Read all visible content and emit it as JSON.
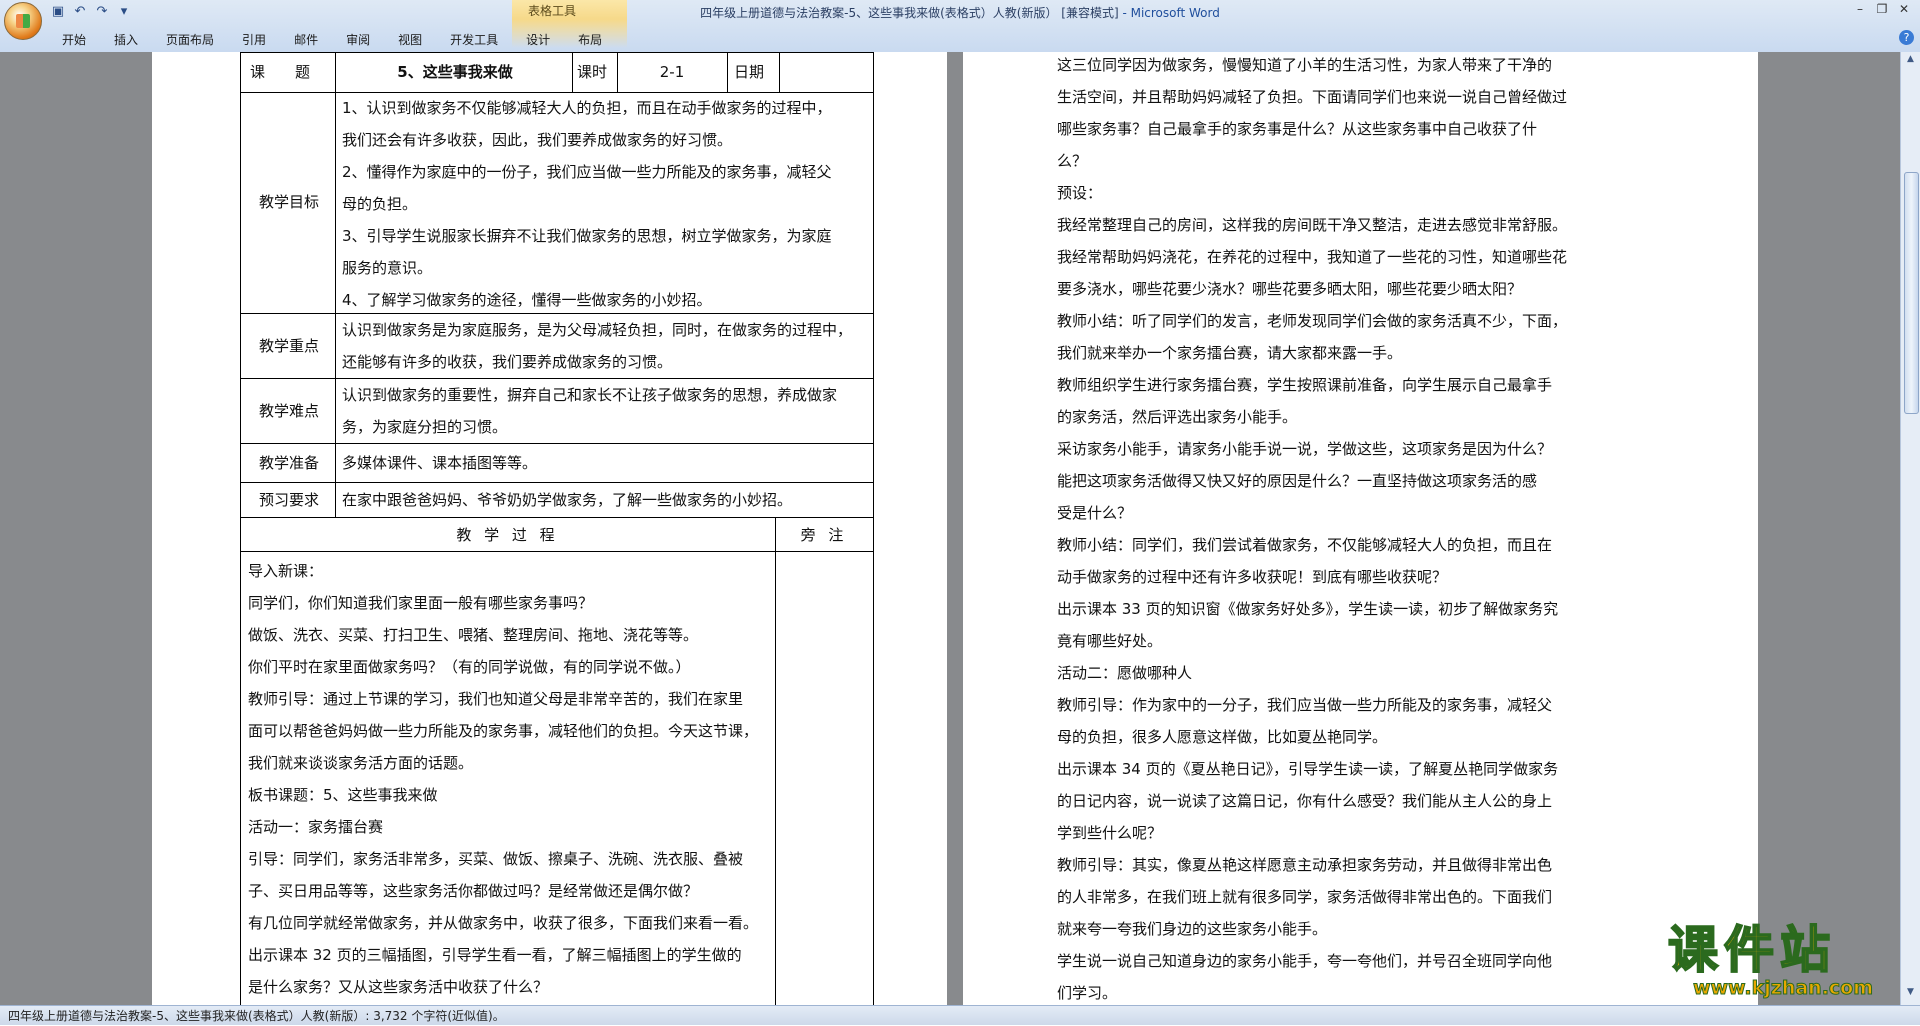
{
  "window": {
    "title": "四年级上册道德与法治教案-5、这些事我来做(表格式）人教(新版） [兼容模式]",
    "app_name": " - Microsoft Word",
    "context_tab_group": "表格工具"
  },
  "ribbon": {
    "tabs": [
      "开始",
      "插入",
      "页面布局",
      "引用",
      "邮件",
      "审阅",
      "视图",
      "开发工具",
      "设计",
      "布局"
    ]
  },
  "lesson_table": {
    "topic_label": "课　　题",
    "topic_value": "5、这些事我来做",
    "period_label": "课时",
    "period_value": "2-1",
    "date_label": "日期",
    "goals_label": "教学目标",
    "goals_lines": [
      "1、认识到做家务不仅能够减轻大人的负担，而且在动手做家务的过程中，",
      "我们还会有许多收获，因此，我们要养成做家务的好习惯。",
      "2、懂得作为家庭中的一份子，我们应当做一些力所能及的家务事，减轻父",
      "母的负担。",
      "3、引导学生说服家长摒弃不让我们做家务的思想，树立学做家务，为家庭",
      "服务的意识。",
      "4、了解学习做家务的途径，懂得一些做家务的小妙招。"
    ],
    "focus_label": "教学重点",
    "focus_lines": [
      "认识到做家务是为家庭服务，是为父母减轻负担，同时，在做家务的过程中，",
      "还能够有许多的收获，我们要养成做家务的习惯。"
    ],
    "difficulty_label": "教学难点",
    "difficulty_lines": [
      "认识到做家务的重要性，摒弃自己和家长不让孩子做家务的思想，养成做家",
      "务，为家庭分担的习惯。"
    ],
    "prep_label": "教学准备",
    "prep_value": "多媒体课件、课本插图等等。",
    "preview_label": "预习要求",
    "preview_value": "在家中跟爸爸妈妈、爷爷奶奶学做家务，了解一些做家务的小妙招。",
    "process_header": "教 学 过 程",
    "notes_header": "旁 注"
  },
  "process_lines": [
    "导入新课：",
    "同学们，你们知道我们家里面一般有哪些家务事吗？",
    "做饭、洗衣、买菜、打扫卫生、喂猪、整理房间、拖地、浇花等等。",
    "你们平时在家里面做家务吗？（有的同学说做，有的同学说不做。）",
    "教师引导：通过上节课的学习，我们也知道父母是非常辛苦的，我们在家里",
    "面可以帮爸爸妈妈做一些力所能及的家务事，减轻他们的负担。今天这节课，",
    "我们就来谈谈家务活方面的话题。",
    "板书课题：5、这些事我来做",
    "活动一：家务擂台赛",
    "引导：同学们，家务活非常多，买菜、做饭、擦桌子、洗碗、洗衣服、叠被",
    "子、买日用品等等，这些家务活你都做过吗？是经常做还是偶尔做？",
    "有几位同学就经常做家务，并从做家务中，收获了很多，下面我们来看一看。",
    "出示课本 32 页的三幅插图，引导学生看一看，了解三幅插图上的学生做的",
    "是什么家务？又从这些家务活中收获了什么？"
  ],
  "page2_lines": [
    "这三位同学因为做家务，慢慢知道了小羊的生活习性，为家人带来了干净的",
    "生活空间，并且帮助妈妈减轻了负担。下面请同学们也来说一说自己曾经做过",
    "哪些家务事？自己最拿手的家务事是什么？从这些家务事中自己收获了什",
    "么？",
    "预设：",
    "我经常整理自己的房间，这样我的房间既干净又整洁，走进去感觉非常舒服。",
    "我经常帮助妈妈浇花，在养花的过程中，我知道了一些花的习性，知道哪些花",
    "要多浇水，哪些花要少浇水？哪些花要多晒太阳，哪些花要少晒太阳？",
    "教师小结：听了同学们的发言，老师发现同学们会做的家务活真不少，下面，",
    "我们就来举办一个家务擂台赛，请大家都来露一手。",
    "教师组织学生进行家务擂台赛，学生按照课前准备，向学生展示自己最拿手",
    "的家务活，然后评选出家务小能手。",
    "采访家务小能手，请家务小能手说一说，学做这些，这项家务是因为什么？",
    "能把这项家务活做得又快又好的原因是什么？一直坚持做这项家务活的感",
    "受是什么？",
    "教师小结：同学们，我们尝试着做家务，不仅能够减轻大人的负担，而且在",
    "动手做家务的过程中还有许多收获呢！到底有哪些收获呢？",
    "出示课本 33 页的知识窗《做家务好处多》，学生读一读，初步了解做家务究",
    "竟有哪些好处。",
    "活动二：愿做哪种人",
    "教师引导：作为家中的一分子，我们应当做一些力所能及的家务事，减轻父",
    "母的负担，很多人愿意这样做，比如夏丛艳同学。",
    "出示课本 34 页的《夏丛艳日记》，引导学生读一读，了解夏丛艳同学做家务",
    "的日记内容，说一说读了这篇日记，你有什么感受？我们能从主人公的身上",
    "学到些什么呢？",
    "教师引导：其实，像夏丛艳这样愿意主动承担家务劳动，并且做得非常出色",
    "的人非常多，在我们班上就有很多同学，家务活做得非常出色的。下面我们",
    "就来夸一夸我们身边的这些家务小能手。",
    "学生说一说自己知道身边的家务小能手，夸一夸他们，并号召全班同学向他",
    "们学习。"
  ],
  "status_bar": "四年级上册道德与法治教案-5、这些事我来做(表格式）人教(新版）: 3,732 个字符(近似值)。",
  "watermark": {
    "brand": "课件站",
    "url": "www.kjzhan.com"
  },
  "colors": {
    "ribbon_bg": "#c9daf0",
    "workspace_bg": "#888a8d",
    "context_tab": "#f6d98a",
    "watermark_fill": "#f4b400",
    "watermark_stroke": "#2b6a1e"
  }
}
